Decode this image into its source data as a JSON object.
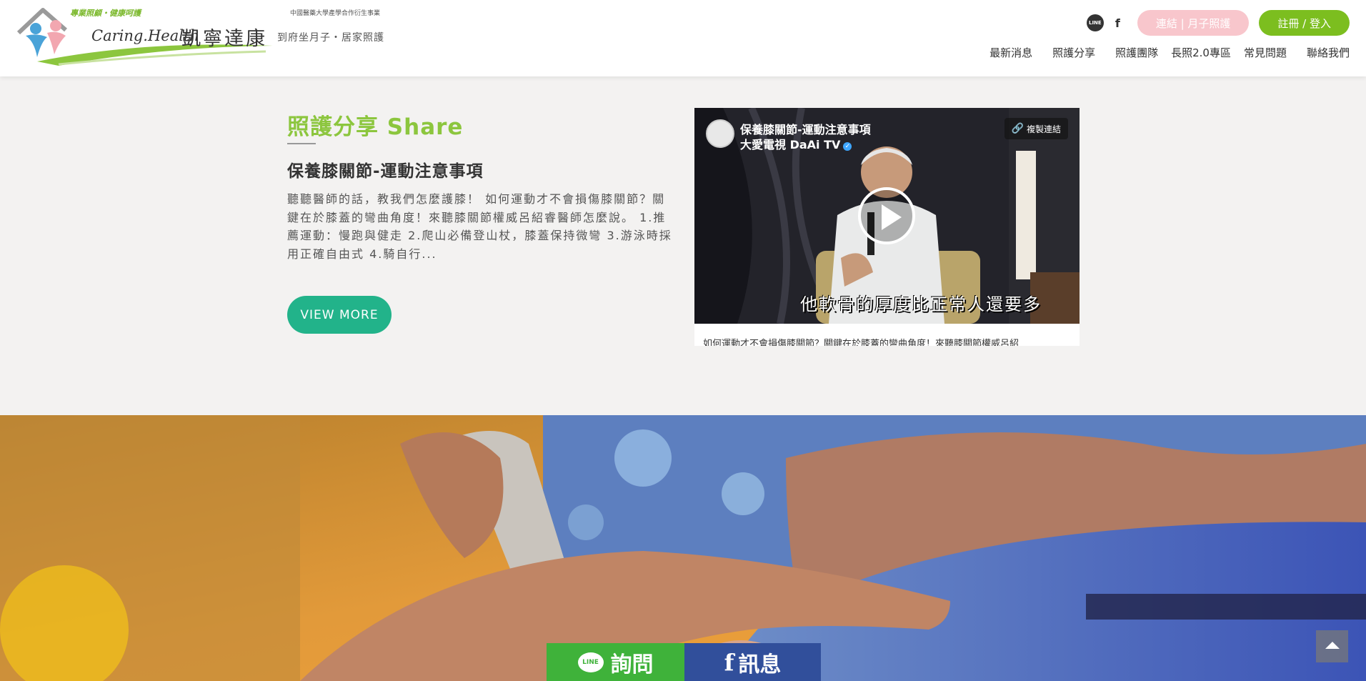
{
  "header": {
    "logo": {
      "tagline": "專業照顧・健康呵護",
      "brand_en": "Caring.Health",
      "brand_zh": "凱寧達康",
      "university_note": "中國醫藥大學產學合作衍生事業",
      "subtitle": "到府坐月子・居家照護"
    },
    "social": {
      "line_icon": "LINE",
      "facebook_icon": "f"
    },
    "buttons": {
      "postpartum": "連結 | 月子照護",
      "auth": "註冊 / 登入"
    },
    "nav": [
      "最新消息",
      "照護分享",
      "照護團隊",
      "長照2.0專區",
      "常見問題",
      "聯絡我們"
    ]
  },
  "share": {
    "section_title": "照護分享 Share",
    "article_title": "保養膝關節-運動注意事項",
    "article_body": "聽聽醫師的話，教我們怎麼護膝！ 如何運動才不會損傷膝關節？關鍵在於膝蓋的彎曲角度！來聽膝關節權威呂紹睿醫師怎麼說。 1.推薦運動：慢跑與健走 2.爬山必備登山杖，膝蓋保持微彎 3.游泳時採用正確自由式 4.騎自行...",
    "view_more": "VIEW MORE"
  },
  "video": {
    "title": "保養膝關節-運動注意事項",
    "channel": "大愛電視 DaAi TV",
    "copy_link": "複製連結",
    "subtitle": "他軟骨的厚度比正常人還要多",
    "description": "如何運動才不會損傷膝關節？關鍵在於膝蓋的彎曲角度！來聽膝關節權威呂紹"
  },
  "floating": {
    "line_label": "詢問",
    "line_badge": "LINE",
    "fb_label": "訊息",
    "fb_icon": "f"
  },
  "colors": {
    "brand_green": "#7cbe1f",
    "share_green": "#8cc63e",
    "teal": "#22b38a",
    "pink": "#f8c6cc",
    "fb_blue": "#314f9b",
    "line_green": "#3fb23a"
  }
}
